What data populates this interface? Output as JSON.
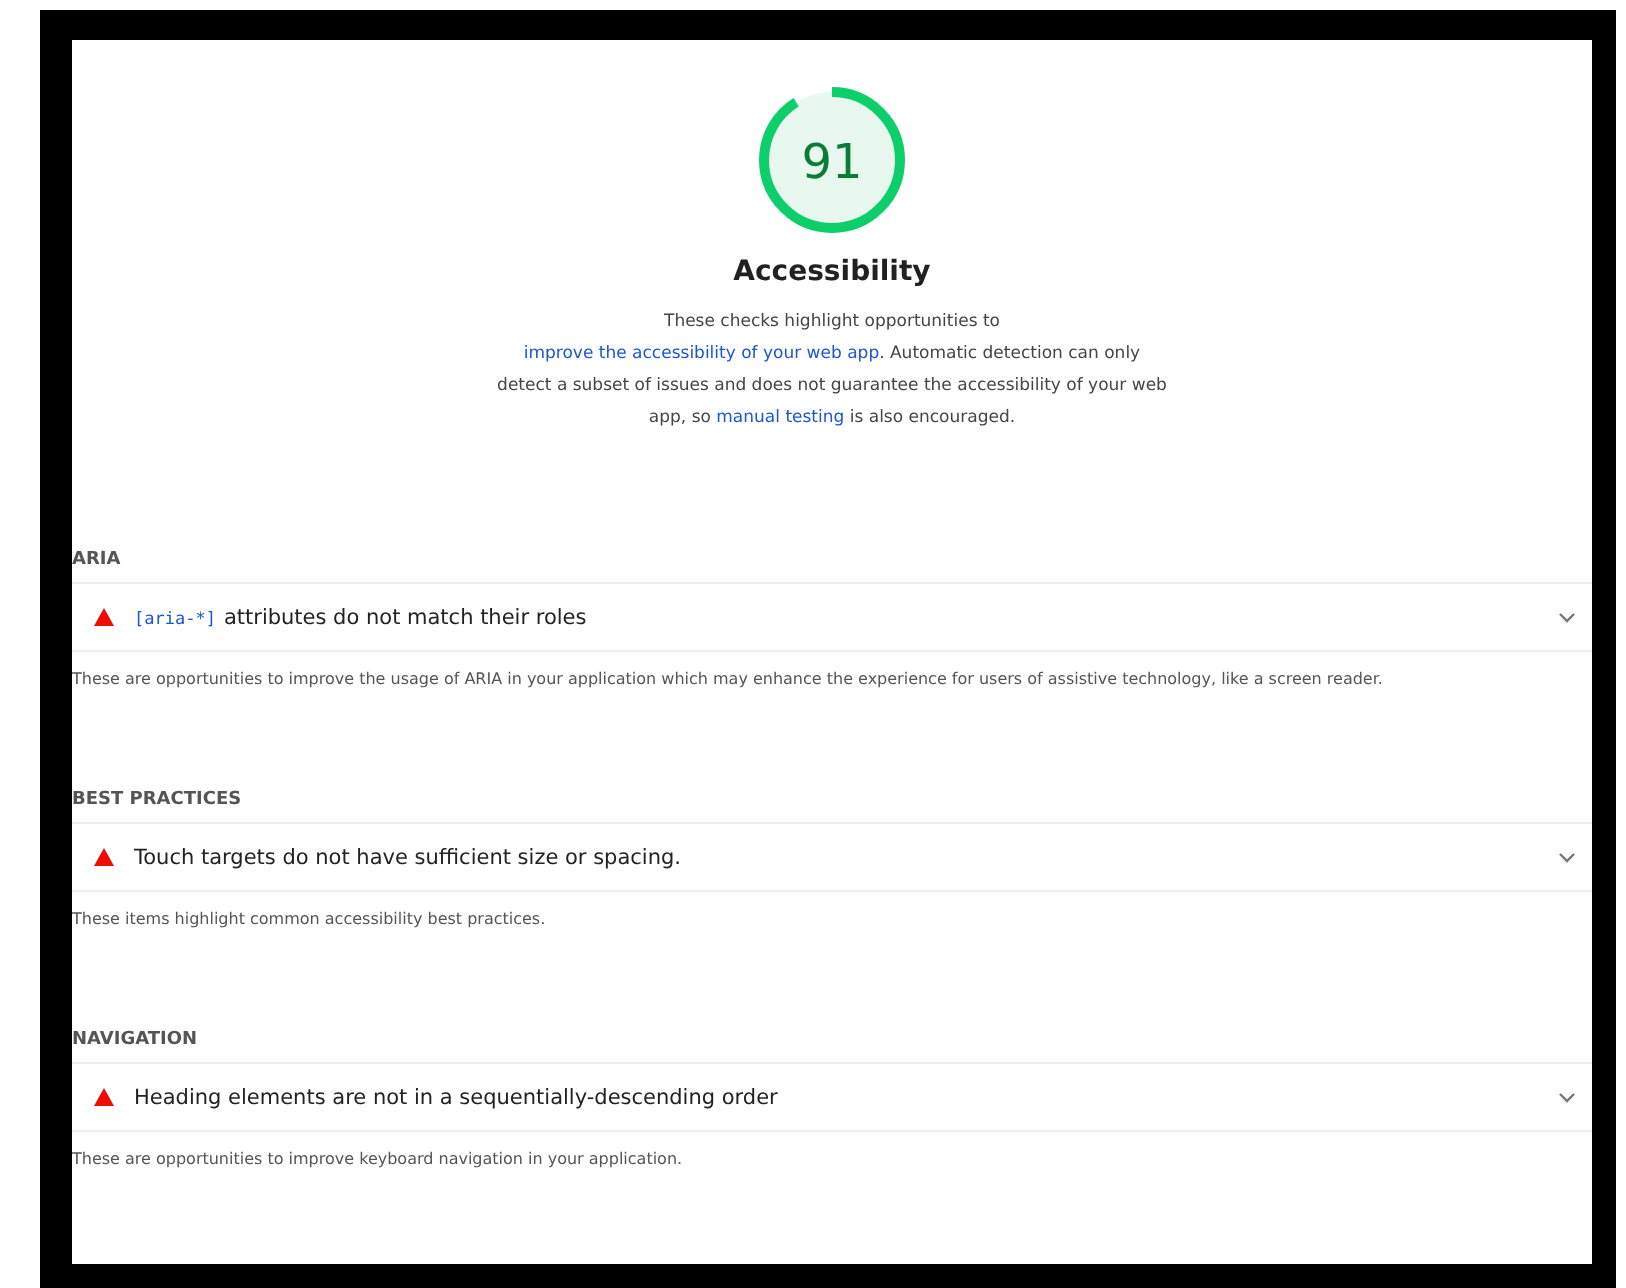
{
  "score": {
    "value": "91"
  },
  "category": {
    "title": "Accessibility",
    "description": [
      {
        "kind": "text",
        "text": "These checks highlight opportunities to "
      },
      {
        "kind": "link",
        "text": "improve the accessibility of your web app"
      },
      {
        "kind": "text",
        "text": ". Automatic detection can only detect a subset of issues and does not guarantee the accessibility of your web app, so "
      },
      {
        "kind": "link",
        "text": "manual testing"
      },
      {
        "kind": "text",
        "text": " is also encouraged."
      }
    ]
  },
  "groups": [
    {
      "heading": "ARIA",
      "audits": [
        {
          "code": "[aria-*]",
          "title": "attributes do not match their roles",
          "expanded": false
        }
      ],
      "description": "These are opportunities to improve the usage of ARIA in your application which may enhance the experience for users of assistive technology, like a screen reader."
    },
    {
      "heading": "BEST PRACTICES",
      "audits": [
        {
          "title": "Touch targets do not have sufficient size or spacing.",
          "expanded": false
        }
      ],
      "description": "These items highlight common accessibility best practices."
    },
    {
      "heading": "NAVIGATION",
      "audits": [
        {
          "title": "Heading elements are not in a sequentially-descending order",
          "expanded": false
        }
      ],
      "description": "These are opportunities to improve keyboard navigation in your application."
    }
  ]
}
